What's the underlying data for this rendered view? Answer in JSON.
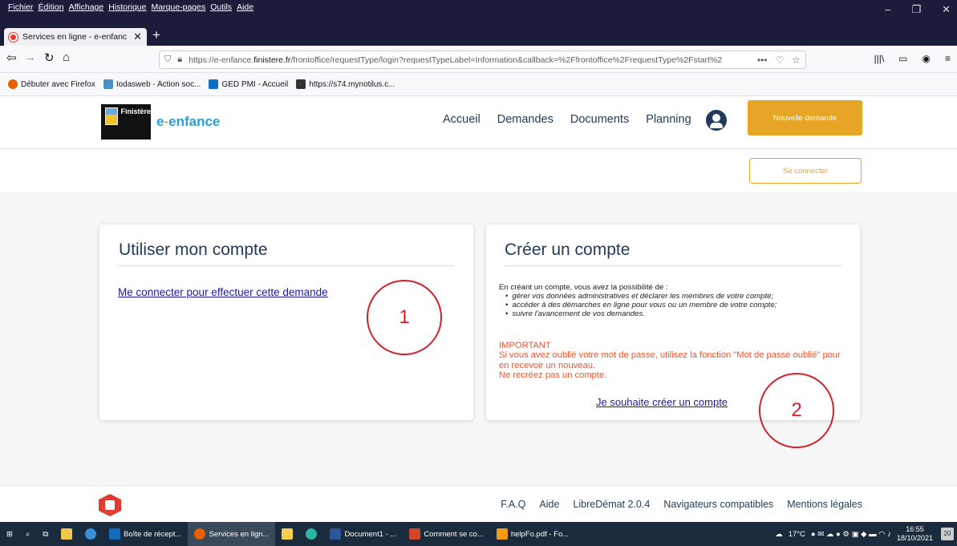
{
  "browser": {
    "menus": [
      "Fichier",
      "Édition",
      "Affichage",
      "Historique",
      "Marque-pages",
      "Outils",
      "Aide"
    ],
    "tab_title": "Services en ligne - e-enfance",
    "url_prefix": "https://e-enfance.",
    "url_domain": "finistere.fr",
    "url_rest": "/frontoffice/requestType/login?requestTypeLabel=Information&callback=%2Ffrontoffice%2FrequestType%2Fstart%2",
    "bookmarks": [
      "Débuter avec Firefox",
      "Iodasweb - Action soc...",
      "GED PMI - Accueil",
      "https://s74.mynotilus.c..."
    ]
  },
  "site": {
    "logo_text": "Finistère",
    "brand_main": "e",
    "brand_dash": "-",
    "brand_rest": "enfance",
    "nav": [
      "Accueil",
      "Demandes",
      "Documents",
      "Planning"
    ],
    "new_request": "Nouvelle demande",
    "login": "Se connecter"
  },
  "card_account": {
    "title": "Utiliser mon compte",
    "link": "Me connecter pour effectuer cette demande"
  },
  "card_create": {
    "title": "Créer un compte",
    "intro": "En créant un compte, vous avez la possibilité de :",
    "bullets": [
      "gérer vos données administratives et déclarer les membres de votre compte;",
      "accéder à des démarches en ligne pour vous ou un membre de votre compte;",
      "suivre l'avancement de vos demandes."
    ],
    "important_title": "IMPORTANT",
    "important_line1": "Si vous avez oublié votre mot de passe, utilisez la fonction \"Mot de passe oublié\" pour en recevoir un nouveau.",
    "important_line2": "Ne recréez pas un compte.",
    "link": "Je souhaite créer un compte"
  },
  "annotations": {
    "one": "1",
    "two": "2"
  },
  "footer": {
    "links": [
      "F.A.Q",
      "Aide",
      "LibreDémat 2.0.4",
      "Navigateurs compatibles",
      "Mentions légales"
    ]
  },
  "taskbar": {
    "items": [
      "Boîte de récept...",
      "Services en lign...",
      "Document1 - ...",
      "Comment se co...",
      "helpFo.pdf - Fo..."
    ],
    "temp": "17°C",
    "time": "16:55",
    "date": "18/10/2021",
    "notif": "20"
  }
}
